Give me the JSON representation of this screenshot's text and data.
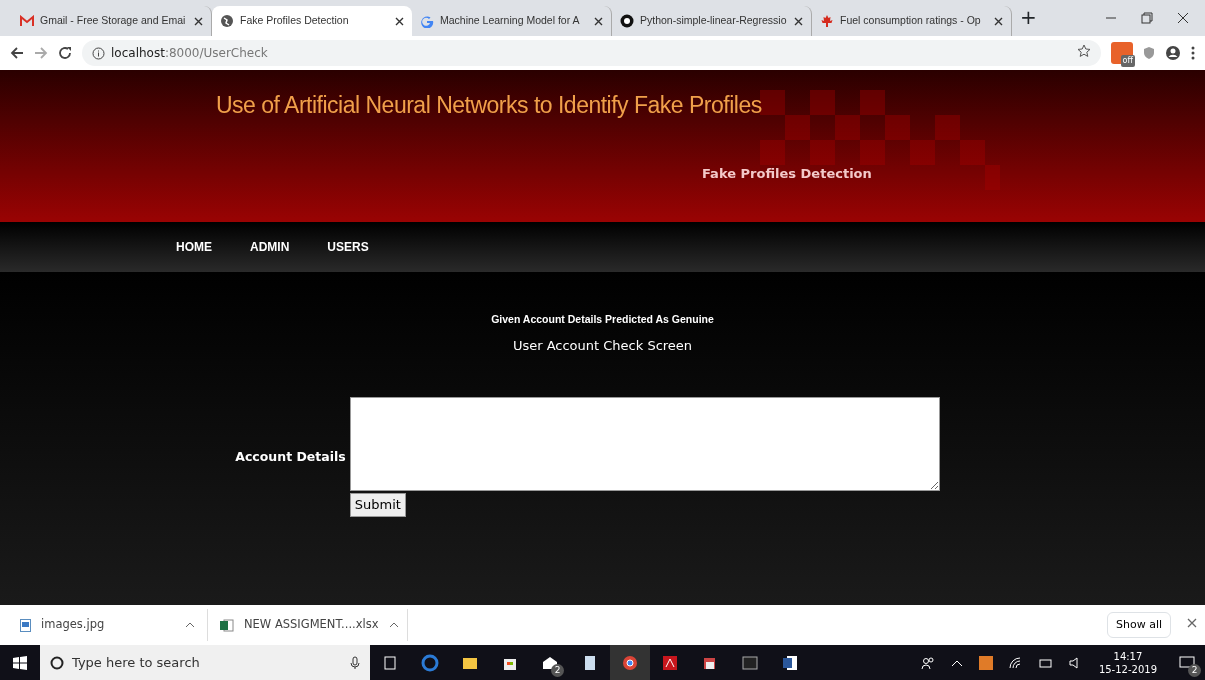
{
  "browser": {
    "tabs": [
      {
        "label": "Gmail - Free Storage and Emai",
        "selected": false
      },
      {
        "label": "Fake Profiles Detection",
        "selected": true
      },
      {
        "label": "Machine Learning Model for A",
        "selected": false
      },
      {
        "label": "Python-simple-linear-Regressio",
        "selected": false
      },
      {
        "label": "Fuel consumption ratings - Op",
        "selected": false
      }
    ],
    "new_tab": "+",
    "address": {
      "host": "localhost",
      "rest": ":8000/UserCheck"
    },
    "extension_badge": "off"
  },
  "page": {
    "title": "Use of Artificial Neural Networks to Identify Fake Profiles",
    "subtitle": "Fake Profiles Detection",
    "nav": [
      "HOME",
      "ADMIN",
      "USERS"
    ],
    "message": "Given Account Details Predicted As Genuine",
    "heading": "User Account Check Screen",
    "form": {
      "label": "Account Details",
      "submit": "Submit"
    }
  },
  "downloads": {
    "items": [
      {
        "name": "images.jpg",
        "kind": "image"
      },
      {
        "name": "NEW ASSIGMENT....xlsx",
        "kind": "excel"
      }
    ],
    "show_all": "Show all"
  },
  "taskbar": {
    "search_placeholder": "Type here to search",
    "mail_count": "2",
    "time": "14:17",
    "date": "15-12-2019",
    "notification_count": "2"
  }
}
